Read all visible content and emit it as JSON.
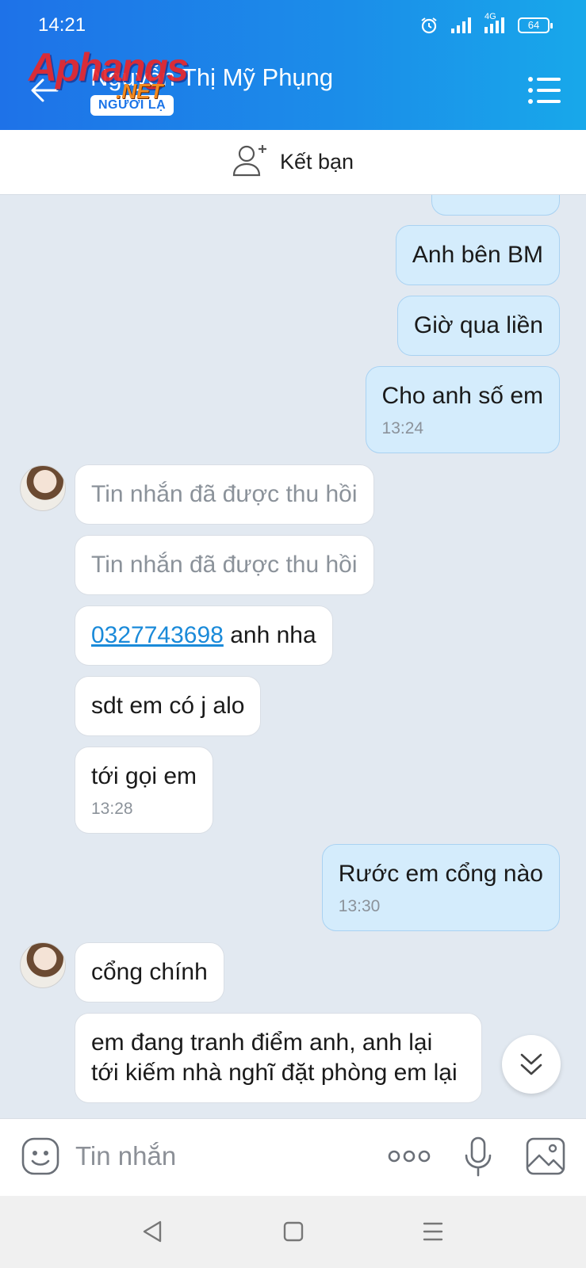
{
  "status_bar": {
    "time": "14:21",
    "network": "4G",
    "battery": "64"
  },
  "header": {
    "title": "Nguyễn Thị Mỹ Phụng",
    "badge": "NGƯỜI LẠ",
    "back_icon": "back-arrow-icon",
    "menu_icon": "list-menu-icon"
  },
  "watermark": {
    "main": "Aphangs",
    "sub": ".NET"
  },
  "add_friend": {
    "label": "Kết bạn",
    "icon": "add-person-icon"
  },
  "messages": [
    {
      "from": "me",
      "text": "Anh bên BM"
    },
    {
      "from": "me",
      "text": "Giờ qua liền"
    },
    {
      "from": "me",
      "text": "Cho anh số em",
      "time": "13:24"
    },
    {
      "from": "them",
      "text": "Tin nhắn đã được thu hồi",
      "recalled": true
    },
    {
      "from": "them",
      "text": "Tin nhắn đã được thu hồi",
      "recalled": true
    },
    {
      "from": "them",
      "phone": "0327743698",
      "text": " anh nha"
    },
    {
      "from": "them",
      "text": "sdt em có j alo"
    },
    {
      "from": "them",
      "text": "tới gọi em",
      "time": "13:28"
    },
    {
      "from": "me",
      "text": "Rước em cổng nào",
      "time": "13:30"
    },
    {
      "from": "them",
      "text": "cổng chính"
    },
    {
      "from": "them",
      "text": "em đang tranh điểm anh, anh lại tới kiếm nhà nghĩ đặt phòng em lại"
    }
  ],
  "input": {
    "placeholder": "Tin nhắn",
    "icons": [
      "emoji-icon",
      "more-icon",
      "microphone-icon",
      "image-icon"
    ]
  },
  "navbar": {
    "icons": [
      "nav-back-icon",
      "nav-home-icon",
      "nav-recents-icon"
    ]
  },
  "colors": {
    "header_start": "#1e72e8",
    "header_end": "#18a8ea",
    "sent_bubble": "#d4ecfc",
    "chat_bg": "#e2e9f1",
    "link": "#1a8ad9"
  }
}
